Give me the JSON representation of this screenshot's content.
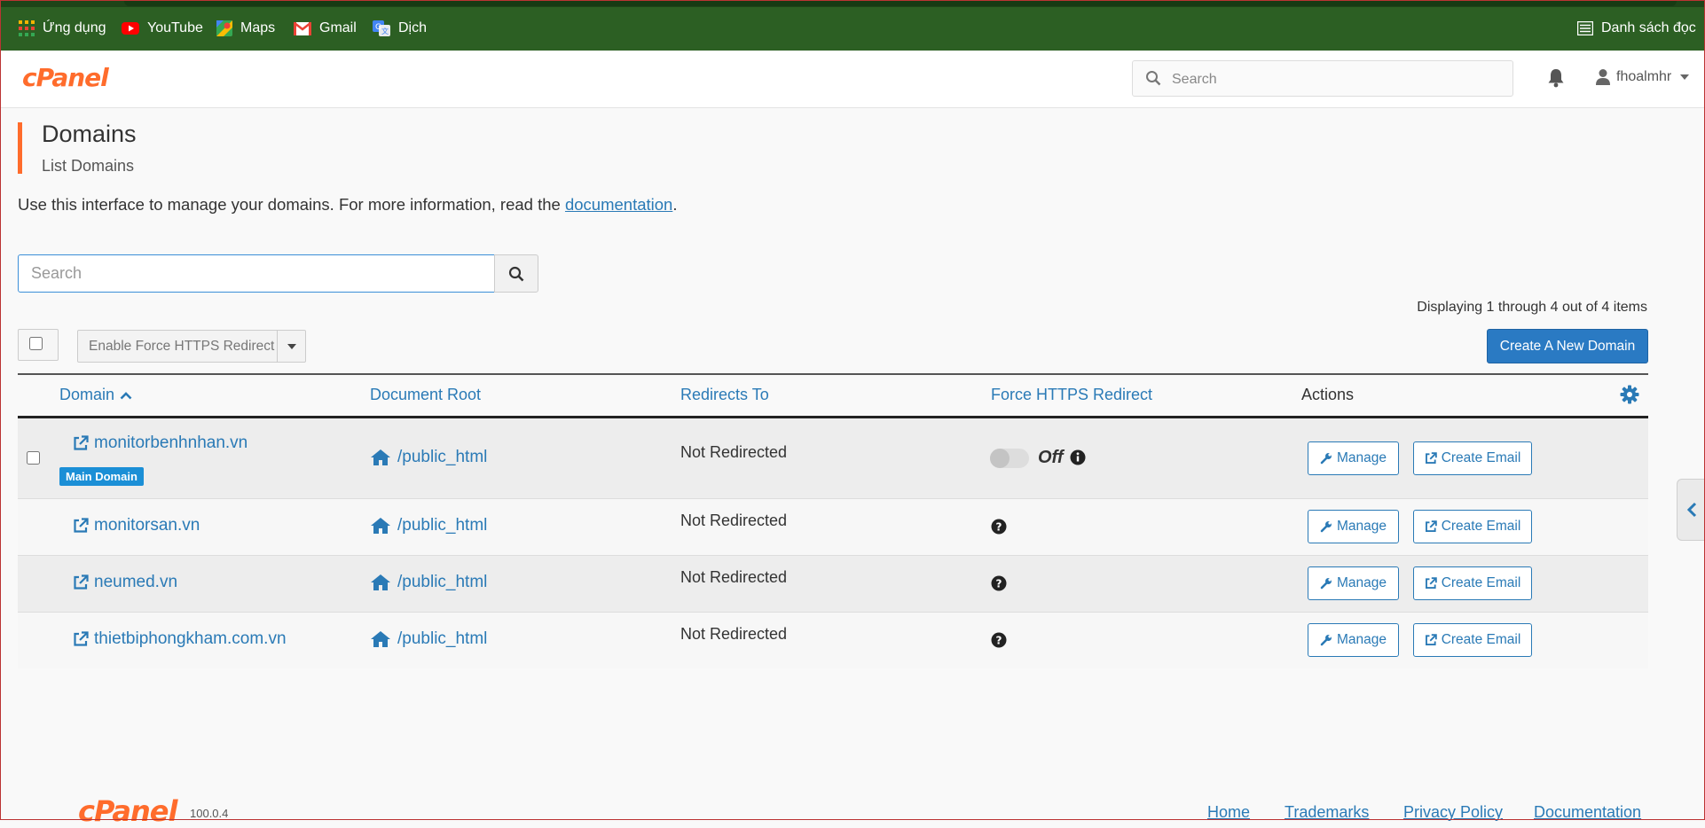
{
  "bookmarks": {
    "items": [
      {
        "label": "Ứng dụng",
        "icon": "apps-grid-icon"
      },
      {
        "label": "YouTube",
        "icon": "youtube-icon"
      },
      {
        "label": "Maps",
        "icon": "maps-icon"
      },
      {
        "label": "Gmail",
        "icon": "gmail-icon"
      },
      {
        "label": "Dịch",
        "icon": "translate-icon"
      }
    ],
    "reading_list": {
      "label": "Danh sách đọc",
      "icon": "reading-list-icon"
    }
  },
  "header": {
    "logo": "cPanel",
    "search_placeholder": "Search",
    "username": "fhoalmhr"
  },
  "page": {
    "title": "Domains",
    "subtitle": "List Domains",
    "intro_text": "Use this interface to manage your domains. For more information, read the ",
    "intro_link": "documentation",
    "intro_end": "."
  },
  "search": {
    "placeholder": "Search"
  },
  "toolbar": {
    "bulk_action_label": "Enable Force HTTPS Redirect",
    "display_info": "Displaying 1 through 4 out of 4 items",
    "create_button": "Create A New Domain"
  },
  "table": {
    "headers": {
      "domain": "Domain",
      "document_root": "Document Root",
      "redirects_to": "Redirects To",
      "force_https": "Force HTTPS Redirect",
      "actions": "Actions"
    },
    "rows": [
      {
        "domain": "monitorbenhnhan.vn",
        "badge": "Main Domain",
        "document_root": "/public_html",
        "redirects_to": "Not Redirected",
        "force_https": "Off",
        "manage": "Manage",
        "create_email": "Create Email"
      },
      {
        "domain": "monitorsan.vn",
        "document_root": "/public_html",
        "redirects_to": "Not Redirected",
        "manage": "Manage",
        "create_email": "Create Email"
      },
      {
        "domain": "neumed.vn",
        "document_root": "/public_html",
        "redirects_to": "Not Redirected",
        "manage": "Manage",
        "create_email": "Create Email"
      },
      {
        "domain": "thietbiphongkham.com.vn",
        "document_root": "/public_html",
        "redirects_to": "Not Redirected",
        "manage": "Manage",
        "create_email": "Create Email"
      }
    ]
  },
  "footer": {
    "logo": "cPanel",
    "version": "100.0.4",
    "links": [
      "Home",
      "Trademarks",
      "Privacy Policy",
      "Documentation"
    ]
  },
  "colors": {
    "bookmarks_bar": "#2c5f23",
    "brand_orange": "#ff6c2c",
    "link_blue": "#2a7ab6",
    "primary_button": "#2a7ac3",
    "badge_blue": "#1b8fd6"
  }
}
